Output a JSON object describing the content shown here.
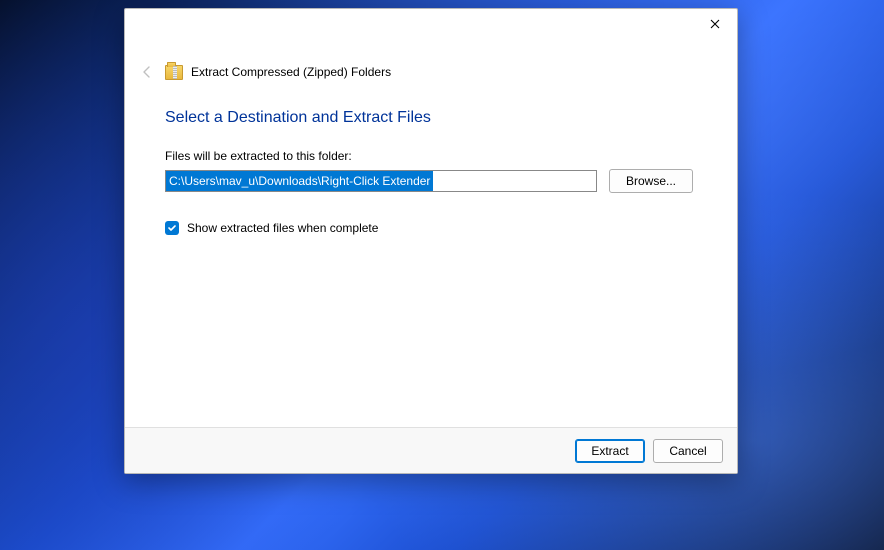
{
  "dialog": {
    "title": "Extract Compressed (Zipped) Folders",
    "heading": "Select a Destination and Extract Files",
    "path_label": "Files will be extracted to this folder:",
    "path_value": "C:\\Users\\mav_u\\Downloads\\Right-Click Extender",
    "browse_label": "Browse...",
    "checkbox_label": "Show extracted files when complete",
    "checkbox_checked": true,
    "extract_label": "Extract",
    "cancel_label": "Cancel"
  }
}
